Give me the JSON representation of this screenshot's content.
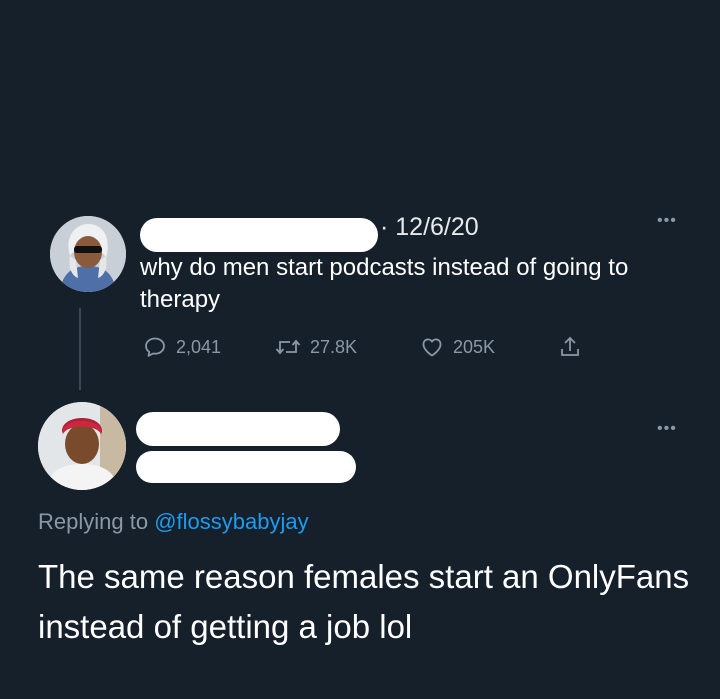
{
  "original_tweet": {
    "date": "· 12/6/20",
    "more_icon": "•••",
    "text": "why do men start podcasts instead of going to therapy",
    "actions": {
      "reply_count": "2,041",
      "retweet_count": "27.8K",
      "like_count": "205K"
    }
  },
  "reply_tweet": {
    "more_icon": "•••",
    "replying_to_prefix": "Replying to ",
    "replying_to_handle": "@flossybabyjay",
    "text": "The same reason females start an OnlyFans instead of getting a job lol"
  },
  "icons": {
    "reply": "speech-bubble-icon",
    "retweet": "retweet-arrows-icon",
    "like": "heart-icon",
    "share": "share-upload-icon",
    "more": "ellipsis-icon"
  },
  "colors": {
    "background": "#15202b",
    "text": "#ffffff",
    "secondary_text": "#8b98a5",
    "link": "#1d9bf0"
  }
}
